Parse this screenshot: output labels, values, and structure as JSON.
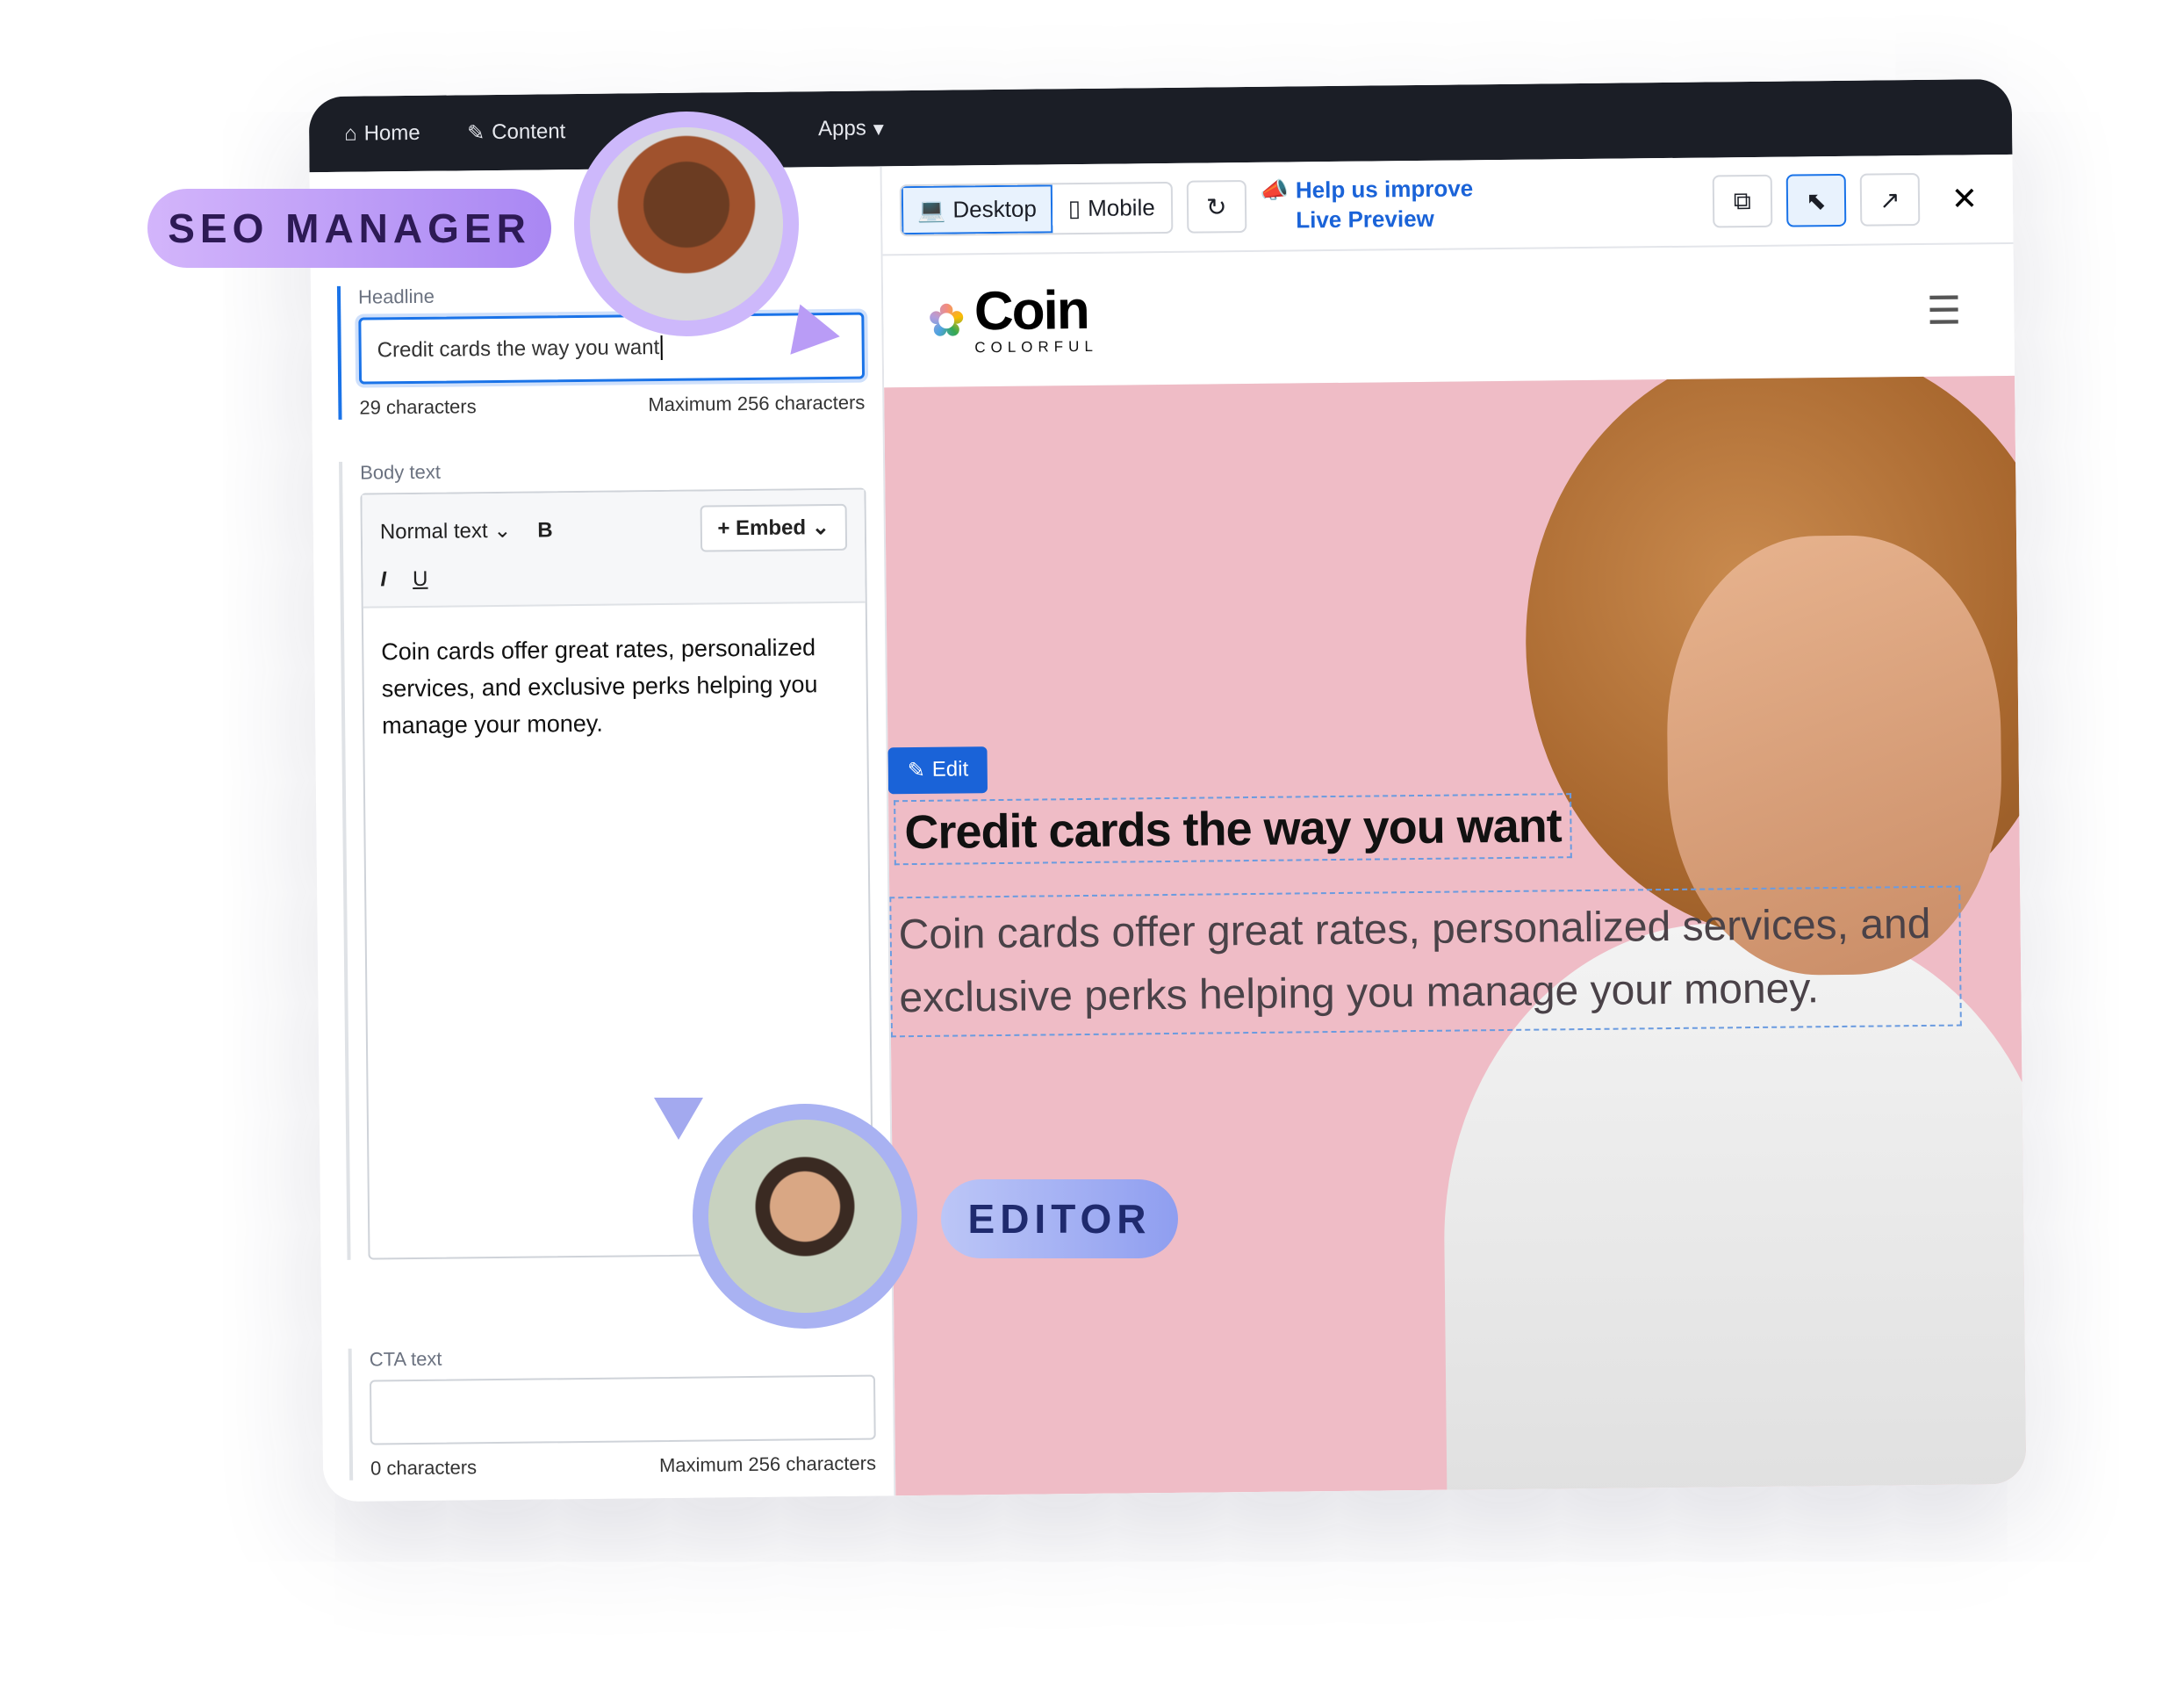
{
  "nav": {
    "items": [
      {
        "label": "Home",
        "icon": "home-icon"
      },
      {
        "label": "Content",
        "icon": "pen-icon"
      },
      {
        "label": "Apps",
        "icon": "chevron-down-icon"
      }
    ]
  },
  "roles": {
    "seo": "SEO MANAGER",
    "editor": "EDITOR"
  },
  "form": {
    "headline": {
      "label": "Headline",
      "value": "Credit cards the way you want",
      "count": "29 characters",
      "max": "Maximum 256 characters"
    },
    "body": {
      "label": "Body text",
      "style": "Normal text",
      "bold": "B",
      "italic": "I",
      "underline": "U",
      "embed": "Embed",
      "value": "Coin cards offer great rates, personalized services, and exclusive perks helping you manage your money."
    },
    "cta": {
      "label": "CTA text",
      "value": "",
      "count": "0 characters",
      "max": "Maximum 256 characters"
    }
  },
  "preview": {
    "desktop": "Desktop",
    "mobile": "Mobile",
    "help": "Help us improve Live Preview",
    "logo": {
      "word": "Coin",
      "sub": "COLORFUL"
    },
    "edit": "Edit",
    "title": "Credit cards the way you want",
    "body": "Coin cards offer great rates, personalized services, and exclusive perks helping you manage your money."
  },
  "colors": {
    "accent": "#1a63d8",
    "hero_bg": "#efbcc6",
    "nav_bg": "#1b1e26",
    "seo_pill": "#c1a3f8",
    "editor_pill": "#a6b2f3"
  }
}
